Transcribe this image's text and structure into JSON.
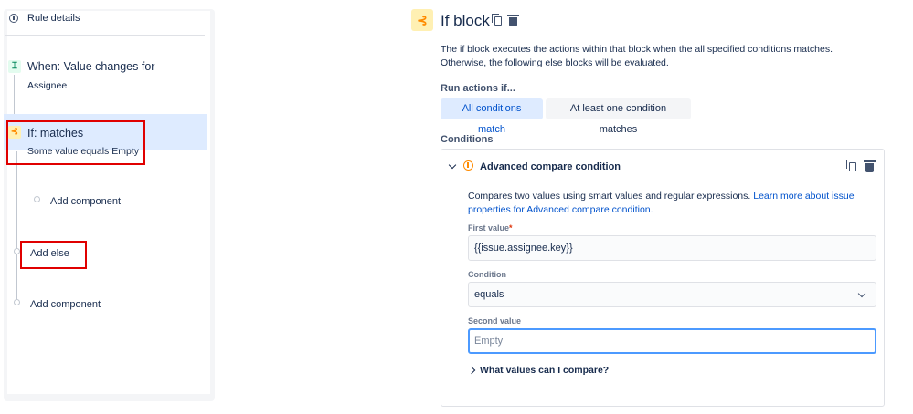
{
  "left_panel": {
    "rule_details": "Rule details",
    "trigger": {
      "title": "When: Value changes for",
      "subtitle": "Assignee"
    },
    "if_block": {
      "title": "If: matches",
      "subtitle": "Some value equals Empty"
    },
    "add_component_inner": "Add component",
    "add_else": "Add else",
    "add_component_outer": "Add component"
  },
  "right_panel": {
    "title": "If block",
    "description": "The if block executes the actions within that block when the all specified conditions matches. Otherwise, the following else blocks will be evaluated.",
    "run_actions_label": "Run actions if...",
    "options": [
      "All conditions match",
      "At least one condition matches"
    ],
    "selected_option": "All conditions match",
    "conditions_label": "Conditions",
    "condition": {
      "title": "Advanced compare condition",
      "description_text": "Compares two values using smart values and regular expressions. ",
      "description_link": "Learn more about issue properties for Advanced compare condition.",
      "first_value_label": "First value",
      "required_mark": "*",
      "first_value": "{{issue.assignee.key}}",
      "condition_label": "Condition",
      "condition_value": "equals",
      "second_value_label": "Second value",
      "second_value_placeholder": "Empty",
      "what_values": "What values can I compare?"
    }
  },
  "colors": {
    "accent": "#0052cc",
    "selected_bg": "#deebff",
    "annotation_red": "#e00000",
    "if_icon": "#ff8b00",
    "trigger_icon": "#00875a"
  },
  "icons": [
    "info-icon",
    "trigger-icon",
    "branch-icon",
    "copy-icon",
    "trash-icon",
    "chevron-down-icon",
    "chevron-right-icon",
    "warning-icon"
  ]
}
